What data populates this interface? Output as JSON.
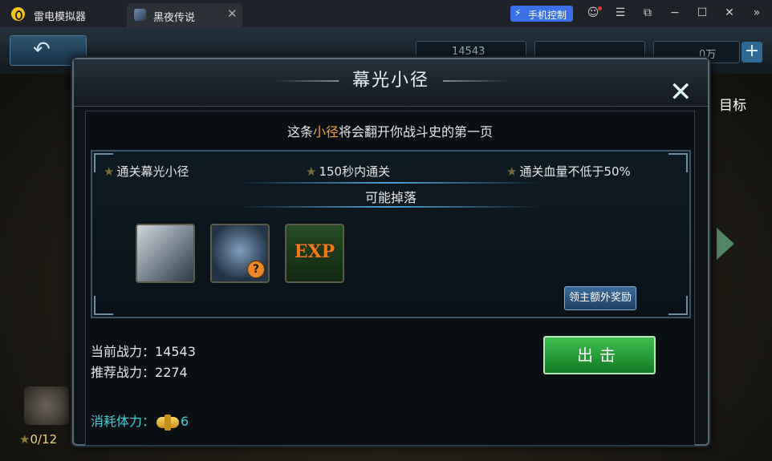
{
  "titlebar": {
    "app_name": "雷电模拟器",
    "tab_label": "黑夜传说",
    "tab_close": "✕",
    "phone_control": "手机控制",
    "icons": [
      "account-icon",
      "menu-icon",
      "popout-icon",
      "minimize-icon",
      "maximize-icon",
      "close-icon",
      "expand-icon"
    ]
  },
  "game_hud": {
    "resource1": "14543",
    "resource3": "0万",
    "target_label": "目标",
    "stars_progress": "0/12"
  },
  "dialog": {
    "title": "幕光小径",
    "subtitle_pre": "这条",
    "subtitle_highlight": "小径",
    "subtitle_post": "将会翻开你战斗史的第一页",
    "goals": [
      "通关幕光小径",
      "150秒内通关",
      "通关血量不低于50%"
    ],
    "drops_title": "可能掉落",
    "drops": [
      {
        "name": "iron-ingot",
        "label": ""
      },
      {
        "name": "knight-unknown",
        "label": "?"
      },
      {
        "name": "exp",
        "label": "EXP"
      }
    ],
    "lord_bonus_button": "领主额外奖励",
    "current_power_label": "当前战力：",
    "current_power": "14543",
    "recommended_power_label": "推荐战力：",
    "recommended_power": "2274",
    "stamina_label": "消耗体力：",
    "stamina_cost": "6",
    "attack_button": "出击"
  },
  "colors": {
    "highlight": "#f4a43b",
    "stamina": "#3fd0d6",
    "attack_green": "#2a9e3a",
    "phone_blue": "#3a6fe8"
  }
}
